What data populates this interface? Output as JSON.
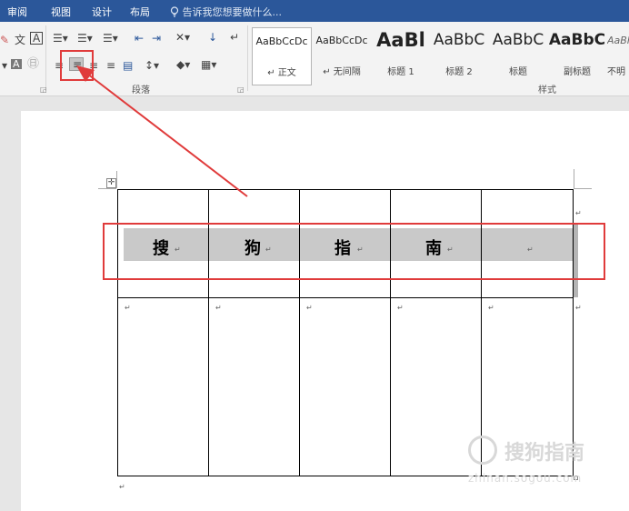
{
  "menubar": {
    "tabs": [
      "审阅",
      "视图",
      "设计",
      "布局"
    ],
    "tell_me": "告诉我您想要做什么..."
  },
  "ribbon": {
    "paragraph_group_label": "段落",
    "styles_group_label": "样式",
    "styles": [
      {
        "sample": "AaBbCcDc",
        "name": "↵ 正文"
      },
      {
        "sample": "AaBbCcDc",
        "name": "↵ 无间隔"
      },
      {
        "sample": "AaBl",
        "name": "标题 1"
      },
      {
        "sample": "AaBbC",
        "name": "标题 2"
      },
      {
        "sample": "AaBbC",
        "name": "标题"
      },
      {
        "sample": "AaBbC",
        "name": "副标题"
      },
      {
        "sample": "AaBl",
        "name": "不明"
      }
    ]
  },
  "table": {
    "header_cells": [
      "搜",
      "狗",
      "指",
      "南",
      ""
    ],
    "paragraph_mark": "↵"
  },
  "watermark": {
    "brand": "搜狗指南",
    "url": "zhinan.sogou.com"
  },
  "colors": {
    "menubar": "#2b579a",
    "highlight_red": "#e03b3b",
    "cell_shading": "#c9c9c9"
  }
}
